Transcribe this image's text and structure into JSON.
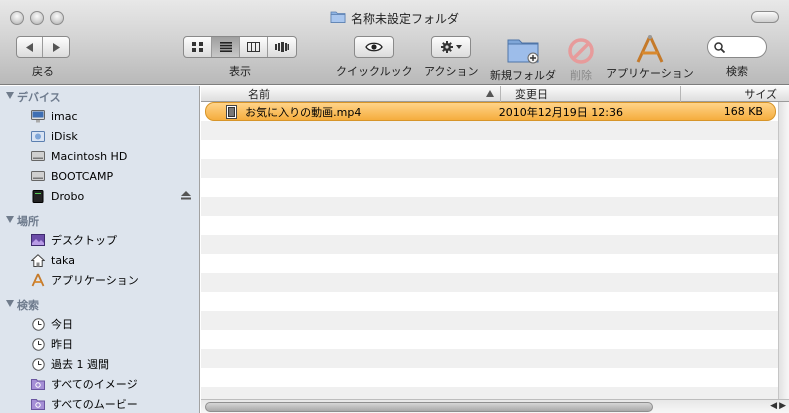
{
  "window": {
    "title": "名称未設定フォルダ"
  },
  "toolbar": {
    "back_label": "戻る",
    "view_label": "表示",
    "quicklook_label": "クイックルック",
    "action_label": "アクション",
    "newfolder_label": "新規フォルダ",
    "delete_label": "削除",
    "applications_label": "アプリケーション",
    "search_label": "検索",
    "search_placeholder": ""
  },
  "sidebar": {
    "devices": {
      "header": "デバイス",
      "items": [
        {
          "label": "imac",
          "icon": "imac-icon"
        },
        {
          "label": "iDisk",
          "icon": "idisk-icon"
        },
        {
          "label": "Macintosh HD",
          "icon": "hard-disk-icon"
        },
        {
          "label": "BOOTCAMP",
          "icon": "hard-disk-icon"
        },
        {
          "label": "Drobo",
          "icon": "drobo-icon"
        }
      ]
    },
    "places": {
      "header": "場所",
      "items": [
        {
          "label": "デスクトップ",
          "icon": "desktop-icon"
        },
        {
          "label": "taka",
          "icon": "home-icon"
        },
        {
          "label": "アプリケーション",
          "icon": "applications-icon"
        }
      ]
    },
    "search": {
      "header": "検索",
      "items": [
        {
          "label": "今日",
          "icon": "clock-icon"
        },
        {
          "label": "昨日",
          "icon": "clock-icon"
        },
        {
          "label": "過去 1 週間",
          "icon": "clock-icon"
        },
        {
          "label": "すべてのイメージ",
          "icon": "smart-folder-icon"
        },
        {
          "label": "すべてのムービー",
          "icon": "smart-folder-icon"
        }
      ]
    }
  },
  "list": {
    "columns": {
      "name": "名前",
      "date": "変更日",
      "size": "サイズ"
    },
    "files": [
      {
        "name": "お気に入りの動画.mp4",
        "date": "2010年12月19日 12:36",
        "size": "168 KB",
        "selected": true
      }
    ]
  },
  "colors": {
    "selection": "#f5ad3e",
    "sidebar_bg": "#dde4ed",
    "sidebar_header": "#6e7b8d"
  }
}
